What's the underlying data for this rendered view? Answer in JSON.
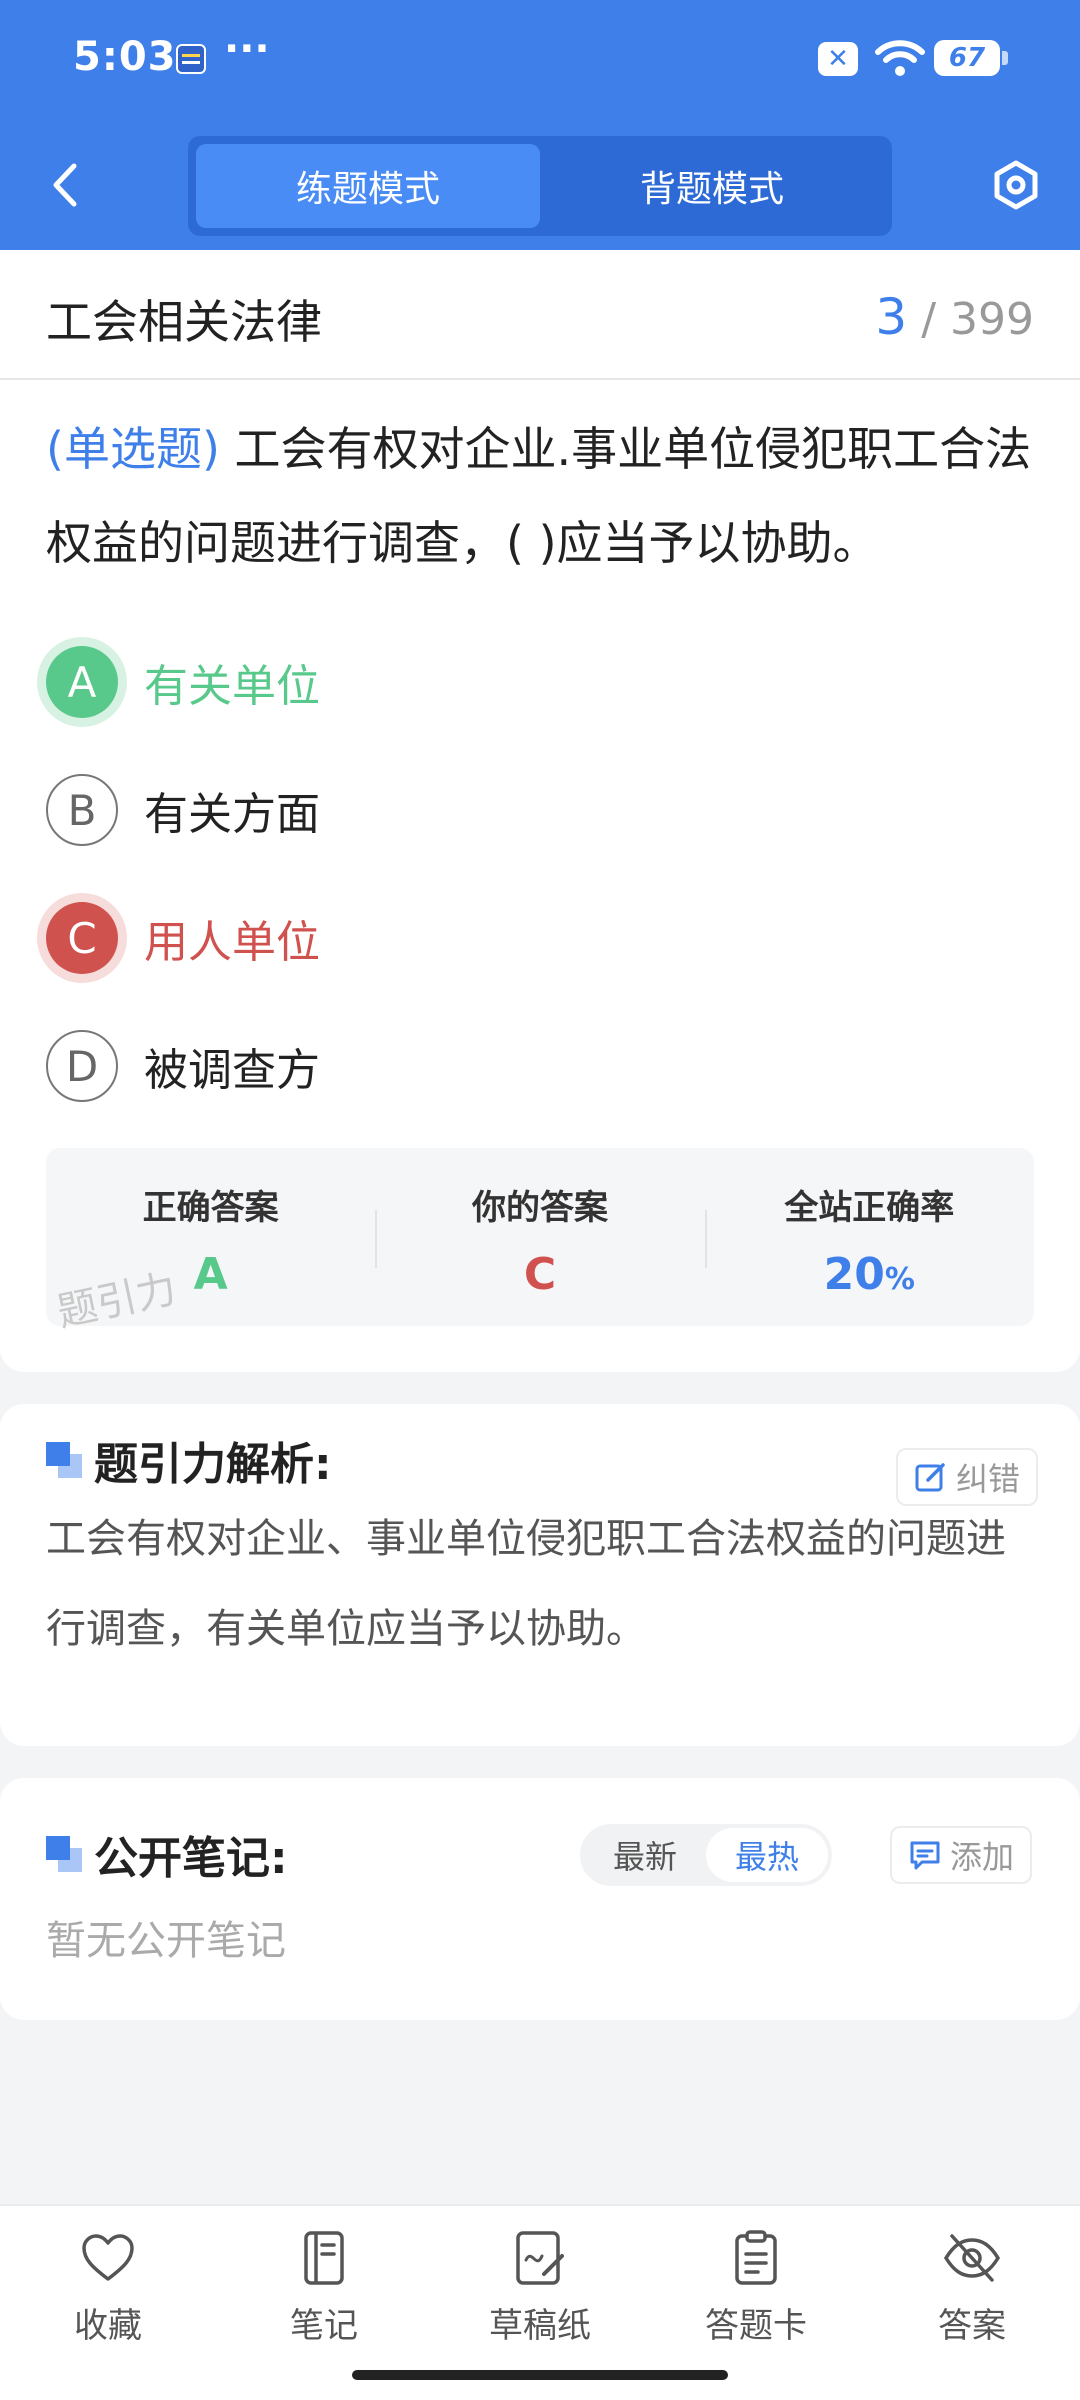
{
  "status_bar": {
    "time": "5:03",
    "dots": "···",
    "battery": "67"
  },
  "header": {
    "tabs": [
      {
        "label": "练题模式",
        "active": true
      },
      {
        "label": "背题模式",
        "active": false
      }
    ]
  },
  "chapter": {
    "title": "工会相关法律",
    "current": "3",
    "separator": "/",
    "total": "399"
  },
  "question": {
    "type_label": "(单选题)",
    "number": "3",
    "text": "工会有权对企业.事业单位侵犯职工合法权益的问题进行调查，(        )应当予以协助。"
  },
  "options": [
    {
      "letter": "A",
      "text": "有关单位",
      "state": "correct"
    },
    {
      "letter": "B",
      "text": "有关方面",
      "state": "normal"
    },
    {
      "letter": "C",
      "text": "用人单位",
      "state": "wrong"
    },
    {
      "letter": "D",
      "text": "被调查方",
      "state": "normal"
    }
  ],
  "answer_summary": {
    "correct_label": "正确答案",
    "correct_value": "A",
    "yours_label": "你的答案",
    "yours_value": "C",
    "rate_label": "全站正确率",
    "rate_value": "20",
    "rate_unit": "%",
    "watermark": "题引力"
  },
  "analysis": {
    "title": "题引力解析:",
    "report_label": "纠错",
    "text": "工会有权对企业、事业单位侵犯职工合法权益的问题进行调查，有关单位应当予以协助。"
  },
  "notes": {
    "title": "公开笔记:",
    "sort_options": [
      "最新",
      "最热"
    ],
    "active_sort": "最热",
    "add_label": "添加",
    "empty_text": "暂无公开笔记"
  },
  "bottom_nav": [
    {
      "label": "收藏",
      "icon": "heart-icon"
    },
    {
      "label": "笔记",
      "icon": "notebook-icon"
    },
    {
      "label": "草稿纸",
      "icon": "draft-paper-icon"
    },
    {
      "label": "答题卡",
      "icon": "answer-sheet-icon"
    },
    {
      "label": "答案",
      "icon": "eye-off-icon"
    }
  ],
  "colors": {
    "primary": "#3f7fe9",
    "correct": "#58c88b",
    "wrong": "#d0524e"
  }
}
